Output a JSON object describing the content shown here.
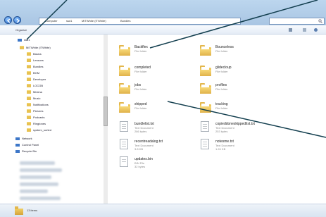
{
  "window": {
    "address_path": [
      "Computer",
      "ssd1",
      "MITWhite (ITWhite)",
      "Bundles"
    ],
    "search_placeholder": "Search"
  },
  "toolbar": {
    "organize_label": "Organize"
  },
  "navigation_pane": {
    "items": [
      {
        "label": "ssd1",
        "icon": "drive-icon"
      },
      {
        "label": "MITWhite (ITWhite)",
        "icon": "folder-icon"
      },
      {
        "label": "Basics",
        "icon": "folder-icon"
      },
      {
        "label": "Lessons",
        "icon": "folder-icon"
      },
      {
        "label": "Bundles",
        "icon": "folder-icon"
      },
      {
        "label": "BOM",
        "icon": "folder-icon"
      },
      {
        "label": "Developer",
        "icon": "folder-icon"
      },
      {
        "label": "LOCGB",
        "icon": "folder-icon"
      },
      {
        "label": "Minima",
        "icon": "folder-icon"
      },
      {
        "label": "Music",
        "icon": "folder-icon"
      },
      {
        "label": "Notifications",
        "icon": "folder-icon"
      },
      {
        "label": "Pictures",
        "icon": "folder-icon"
      },
      {
        "label": "Podcasts",
        "icon": "folder-icon"
      },
      {
        "label": "Ringtones",
        "icon": "folder-icon"
      },
      {
        "label": "system_sorted",
        "icon": "folder-icon"
      },
      {
        "label": "Network",
        "icon": "network-icon"
      },
      {
        "label": "Control Panel",
        "icon": "control-panel-icon"
      },
      {
        "label": "Recycle Bin",
        "icon": "recycle-bin-icon"
      }
    ]
  },
  "files": [
    {
      "name": "Backflex",
      "type": "File folder",
      "kind": "folder"
    },
    {
      "name": "Bounceless",
      "type": "File folder",
      "kind": "folder"
    },
    {
      "name": "completed",
      "type": "File folder",
      "kind": "folder"
    },
    {
      "name": "glidecloup",
      "type": "File folder",
      "kind": "folder"
    },
    {
      "name": "jobs",
      "type": "File folder",
      "kind": "folder"
    },
    {
      "name": "profiles",
      "type": "File folder",
      "kind": "folder"
    },
    {
      "name": "shipped",
      "type": "File folder",
      "kind": "folder"
    },
    {
      "name": "tracking",
      "type": "File folder",
      "kind": "folder"
    },
    {
      "name": "bundlelist.txt",
      "type": "Text Document",
      "size": "286 bytes",
      "kind": "doc"
    },
    {
      "name": "copieddoneskippedlist.txt",
      "type": "Text Document",
      "size": "253 bytes",
      "kind": "doc"
    },
    {
      "name": "recentreadalog.txt",
      "type": "Text Document",
      "size": "3.8 KB",
      "kind": "doc"
    },
    {
      "name": "notesme.txt",
      "type": "Text Document",
      "size": "1.24 KB",
      "kind": "doc"
    },
    {
      "name": "updates.bin",
      "type": "BIN File",
      "size": "32 bytes",
      "kind": "doc"
    }
  ],
  "status_bar": {
    "item_count": "13 items"
  }
}
